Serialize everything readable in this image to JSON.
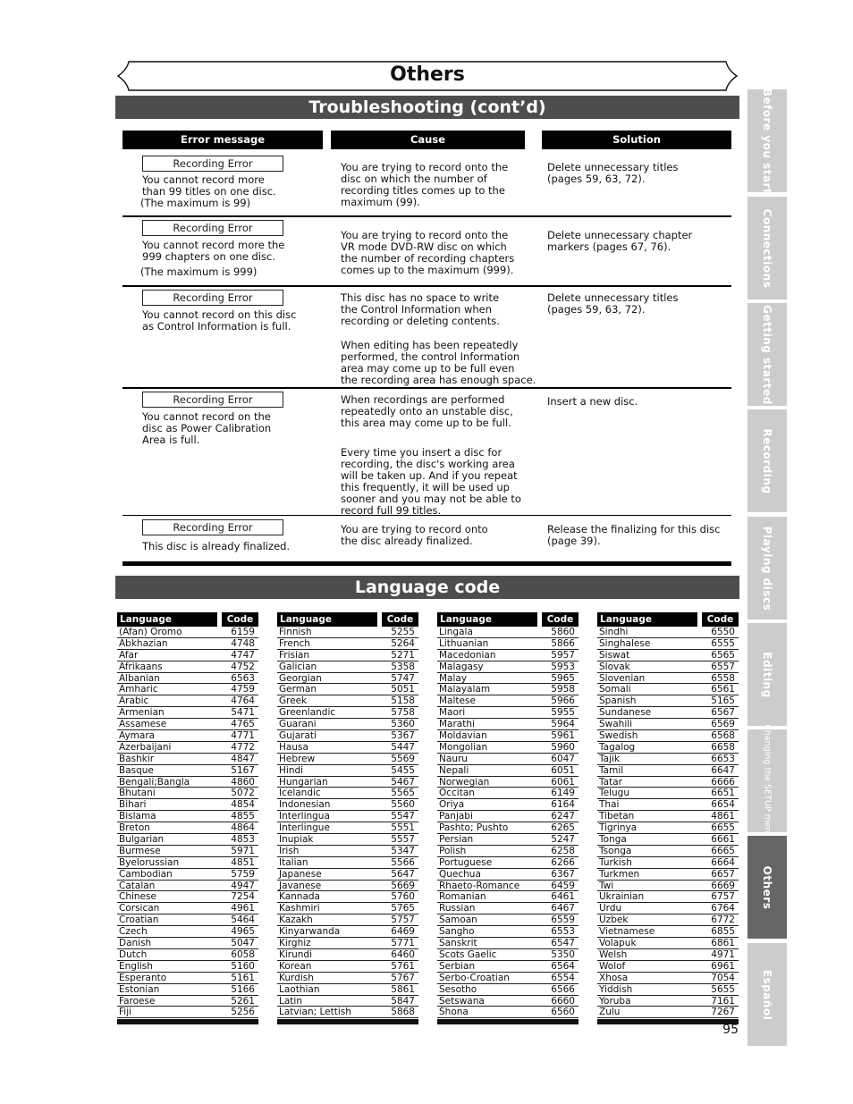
{
  "page": {
    "title": "Others",
    "page_number": "95"
  },
  "troubleshooting": {
    "heading": "Troubleshooting (cont’d)",
    "headers": {
      "error": "Error message",
      "cause": "Cause",
      "solution": "Solution"
    },
    "rows": [
      {
        "error_label": "Recording Error",
        "error_text": "You cannot record more\nthan 99 titles on one disc.",
        "error_note": "(The maximum is 99)",
        "cause": [
          "You are trying to record onto the\ndisc on which the number of\nrecording titles comes up to the\nmaximum (99)."
        ],
        "solution": "Delete unnecessary titles\n(pages 59, 63, 72)."
      },
      {
        "error_label": "Recording Error",
        "error_text": "You cannot record more the\n999 chapters on one disc.",
        "error_note": "(The maximum is 999)",
        "cause": [
          "You are trying to record onto the\nVR mode DVD-RW disc on which\nthe number of recording chapters\ncomes up to the maximum (999)."
        ],
        "solution": "Delete unnecessary chapter\nmarkers (pages 67, 76)."
      },
      {
        "error_label": "Recording Error",
        "error_text": "You cannot record on this disc\nas Control Information is full.",
        "error_note": "",
        "cause": [
          "This disc has no space to write\nthe Control Information when\nrecording or deleting contents.",
          "When editing has been repeatedly\nperformed, the control Information\narea may come up to be full even\nthe recording area has enough space."
        ],
        "solution": "Delete unnecessary titles\n(pages 59, 63, 72)."
      },
      {
        "error_label": "Recording Error",
        "error_text": "You cannot record on the\ndisc as Power Calibration\nArea is full.",
        "error_note": "",
        "cause": [
          "When recordings are performed\nrepeatedly onto an unstable disc,\nthis area may come up to be full.",
          "Every time you insert a disc for\nrecording, the disc's working area\nwill be taken up.  And if you repeat\nthis frequently, it will be used up\nsooner and you may not be able to\nrecord full 99 titles."
        ],
        "solution": "Insert a new disc."
      },
      {
        "error_label": "Recording Error",
        "error_text": "This disc is already finalized.",
        "error_note": "",
        "cause": [
          "You are trying to record onto\nthe disc already finalized."
        ],
        "solution": "Release the finalizing for this disc\n(page 39)."
      }
    ]
  },
  "language_code": {
    "heading": "Language code",
    "col_language": "Language",
    "col_code": "Code",
    "tables": [
      [
        [
          "(Afan) Oromo",
          "6159"
        ],
        [
          "Abkhazian",
          "4748"
        ],
        [
          "Afar",
          "4747"
        ],
        [
          "Afrikaans",
          "4752"
        ],
        [
          "Albanian",
          "6563"
        ],
        [
          "Amharic",
          "4759"
        ],
        [
          "Arabic",
          "4764"
        ],
        [
          "Armenian",
          "5471"
        ],
        [
          "Assamese",
          "4765"
        ],
        [
          "Aymara",
          "4771"
        ],
        [
          "Azerbaijani",
          "4772"
        ],
        [
          "Bashkir",
          "4847"
        ],
        [
          "Basque",
          "5167"
        ],
        [
          "Bengali;Bangla",
          "4860"
        ],
        [
          "Bhutani",
          "5072"
        ],
        [
          "Bihari",
          "4854"
        ],
        [
          "Bislama",
          "4855"
        ],
        [
          "Breton",
          "4864"
        ],
        [
          "Bulgarian",
          "4853"
        ],
        [
          "Burmese",
          "5971"
        ],
        [
          "Byelorussian",
          "4851"
        ],
        [
          "Cambodian",
          "5759"
        ],
        [
          "Catalan",
          "4947"
        ],
        [
          "Chinese",
          "7254"
        ],
        [
          "Corsican",
          "4961"
        ],
        [
          "Croatian",
          "5464"
        ],
        [
          "Czech",
          "4965"
        ],
        [
          "Danish",
          "5047"
        ],
        [
          "Dutch",
          "6058"
        ],
        [
          "English",
          "5160"
        ],
        [
          "Esperanto",
          "5161"
        ],
        [
          "Estonian",
          "5166"
        ],
        [
          "Faroese",
          "5261"
        ],
        [
          "Fiji",
          "5256"
        ]
      ],
      [
        [
          "Finnish",
          "5255"
        ],
        [
          "French",
          "5264"
        ],
        [
          "Frisian",
          "5271"
        ],
        [
          "Galician",
          "5358"
        ],
        [
          "Georgian",
          "5747"
        ],
        [
          "German",
          "5051"
        ],
        [
          "Greek",
          "5158"
        ],
        [
          "Greenlandic",
          "5758"
        ],
        [
          "Guarani",
          "5360"
        ],
        [
          "Gujarati",
          "5367"
        ],
        [
          "Hausa",
          "5447"
        ],
        [
          "Hebrew",
          "5569"
        ],
        [
          "Hindi",
          "5455"
        ],
        [
          "Hungarian",
          "5467"
        ],
        [
          "Icelandic",
          "5565"
        ],
        [
          "Indonesian",
          "5560"
        ],
        [
          "Interlingua",
          "5547"
        ],
        [
          "Interlingue",
          "5551"
        ],
        [
          "Inupiak",
          "5557"
        ],
        [
          "Irish",
          "5347"
        ],
        [
          "Italian",
          "5566"
        ],
        [
          "Japanese",
          "5647"
        ],
        [
          "Javanese",
          "5669"
        ],
        [
          "Kannada",
          "5760"
        ],
        [
          "Kashmiri",
          "5765"
        ],
        [
          "Kazakh",
          "5757"
        ],
        [
          "Kinyarwanda",
          "6469"
        ],
        [
          "Kirghiz",
          "5771"
        ],
        [
          "Kirundi",
          "6460"
        ],
        [
          "Korean",
          "5761"
        ],
        [
          "Kurdish",
          "5767"
        ],
        [
          "Laothian",
          "5861"
        ],
        [
          "Latin",
          "5847"
        ],
        [
          "Latvian; Lettish",
          "5868"
        ]
      ],
      [
        [
          "Lingala",
          "5860"
        ],
        [
          "Lithuanian",
          "5866"
        ],
        [
          "Macedonian",
          "5957"
        ],
        [
          "Malagasy",
          "5953"
        ],
        [
          "Malay",
          "5965"
        ],
        [
          "Malayalam",
          "5958"
        ],
        [
          "Maltese",
          "5966"
        ],
        [
          "Maori",
          "5955"
        ],
        [
          "Marathi",
          "5964"
        ],
        [
          "Moldavian",
          "5961"
        ],
        [
          "Mongolian",
          "5960"
        ],
        [
          "Nauru",
          "6047"
        ],
        [
          "Nepali",
          "6051"
        ],
        [
          "Norwegian",
          "6061"
        ],
        [
          "Occitan",
          "6149"
        ],
        [
          "Oriya",
          "6164"
        ],
        [
          "Panjabi",
          "6247"
        ],
        [
          "Pashto; Pushto",
          "6265"
        ],
        [
          "Persian",
          "5247"
        ],
        [
          "Polish",
          "6258"
        ],
        [
          "Portuguese",
          "6266"
        ],
        [
          "Quechua",
          "6367"
        ],
        [
          "Rhaeto-Romance",
          "6459"
        ],
        [
          "Romanian",
          "6461"
        ],
        [
          "Russian",
          "6467"
        ],
        [
          "Samoan",
          "6559"
        ],
        [
          "Sangho",
          "6553"
        ],
        [
          "Sanskrit",
          "6547"
        ],
        [
          "Scots Gaelic",
          "5350"
        ],
        [
          "Serbian",
          "6564"
        ],
        [
          "Serbo-Croatian",
          "6554"
        ],
        [
          "Sesotho",
          "6566"
        ],
        [
          "Setswana",
          "6660"
        ],
        [
          "Shona",
          "6560"
        ]
      ],
      [
        [
          "Sindhi",
          "6550"
        ],
        [
          "Singhalese",
          "6555"
        ],
        [
          "Siswat",
          "6565"
        ],
        [
          "Slovak",
          "6557"
        ],
        [
          "Slovenian",
          "6558"
        ],
        [
          "Somali",
          "6561"
        ],
        [
          "Spanish",
          "5165"
        ],
        [
          "Sundanese",
          "6567"
        ],
        [
          "Swahili",
          "6569"
        ],
        [
          "Swedish",
          "6568"
        ],
        [
          "Tagalog",
          "6658"
        ],
        [
          "Tajik",
          "6653"
        ],
        [
          "Tamil",
          "6647"
        ],
        [
          "Tatar",
          "6666"
        ],
        [
          "Telugu",
          "6651"
        ],
        [
          "Thai",
          "6654"
        ],
        [
          "Tibetan",
          "4861"
        ],
        [
          "Tigrinya",
          "6655"
        ],
        [
          "Tonga",
          "6661"
        ],
        [
          "Tsonga",
          "6665"
        ],
        [
          "Turkish",
          "6664"
        ],
        [
          "Turkmen",
          "6657"
        ],
        [
          "Twi",
          "6669"
        ],
        [
          "Ukrainian",
          "6757"
        ],
        [
          "Urdu",
          "6764"
        ],
        [
          "Uzbek",
          "6772"
        ],
        [
          "Vietnamese",
          "6855"
        ],
        [
          "Volapuk",
          "6861"
        ],
        [
          "Welsh",
          "4971"
        ],
        [
          "Wolof",
          "6961"
        ],
        [
          "Xhosa",
          "7054"
        ],
        [
          "Yiddish",
          "5655"
        ],
        [
          "Yoruba",
          "7161"
        ],
        [
          "Zulu",
          "7267"
        ]
      ]
    ]
  },
  "side_tabs": [
    {
      "label": "Before you start",
      "active": false
    },
    {
      "label": "Connections",
      "active": false
    },
    {
      "label": "Getting started",
      "active": false
    },
    {
      "label": "Recording",
      "active": false
    },
    {
      "label": "Playing discs",
      "active": false
    },
    {
      "label": "Editing",
      "active": false
    },
    {
      "label": "Changing the SETUP menu",
      "active": false
    },
    {
      "label": "Others",
      "active": true
    },
    {
      "label": "Español",
      "active": false
    }
  ],
  "colors": {
    "section_bar": "#4d4d4d",
    "table_header": "#000000",
    "tab_inactive": "#cccccc",
    "tab_active": "#666666"
  }
}
